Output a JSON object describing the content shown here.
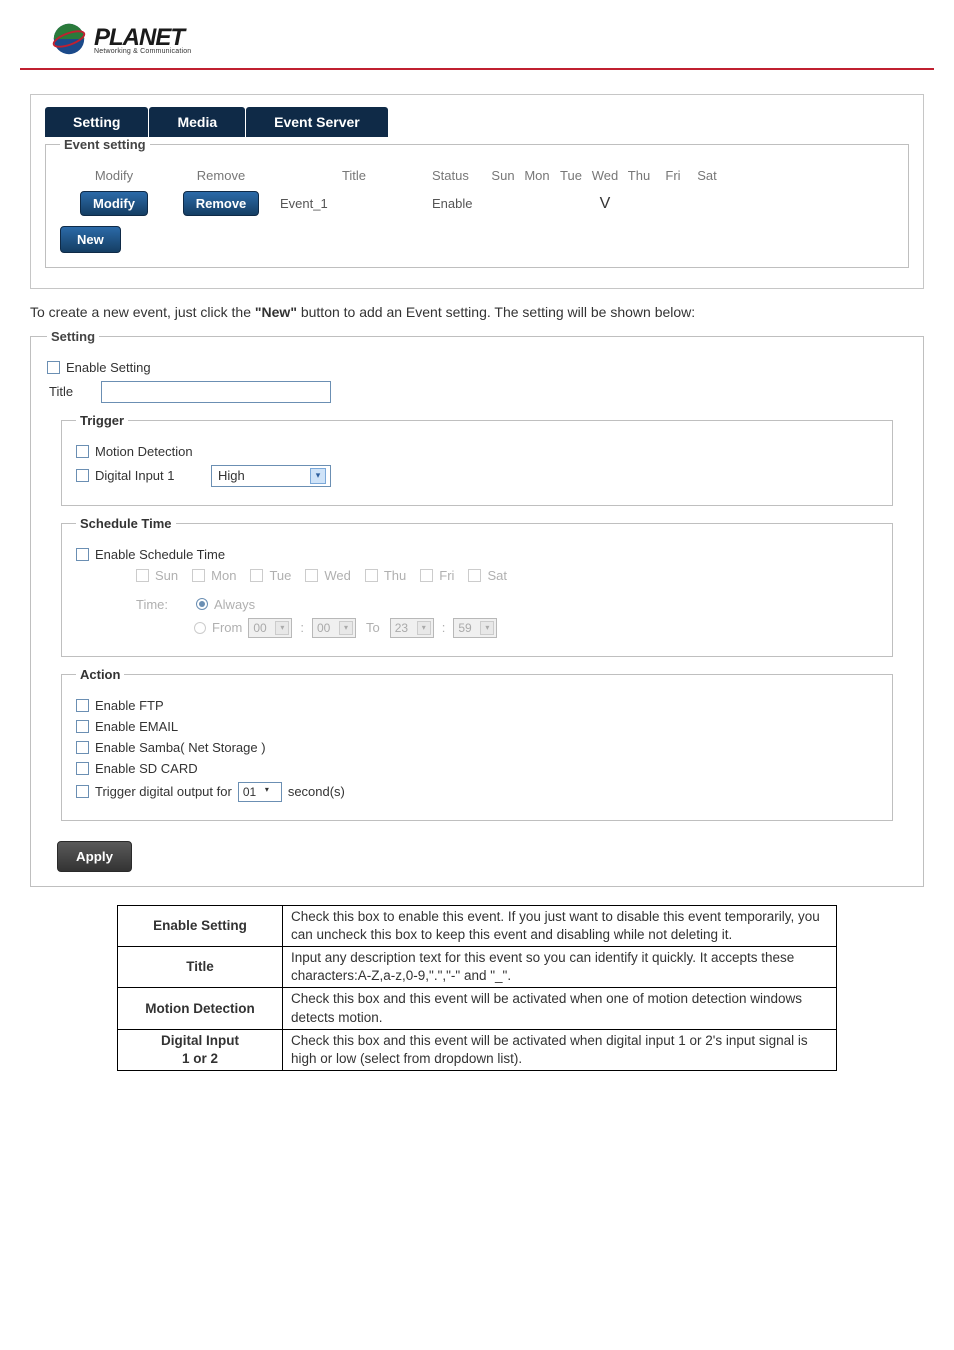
{
  "logo": {
    "brand": "PLANET",
    "tagline": "Networking & Communication"
  },
  "tabs": {
    "setting": "Setting",
    "media": "Media",
    "eventserver": "Event Server"
  },
  "eventSetting": {
    "legend": "Event setting",
    "headers": {
      "modify": "Modify",
      "remove": "Remove",
      "title": "Title",
      "status": "Status",
      "sun": "Sun",
      "mon": "Mon",
      "tue": "Tue",
      "wed": "Wed",
      "thu": "Thu",
      "fri": "Fri",
      "sat": "Sat"
    },
    "row": {
      "modify": "Modify",
      "remove": "Remove",
      "title": "Event_1",
      "status": "Enable",
      "wed": "V"
    },
    "newBtn": "New"
  },
  "paragraph": "To create a new event, just click the \"New\" button to add an Event setting. The setting will be shown below:",
  "setting": {
    "legend": "Setting",
    "enable": "Enable Setting",
    "titleLabel": "Title",
    "trigger": {
      "legend": "Trigger",
      "motion": "Motion Detection",
      "di1": "Digital Input 1",
      "di1val": "High"
    },
    "schedule": {
      "legend": "Schedule Time",
      "enable": "Enable Schedule Time",
      "days": {
        "sun": "Sun",
        "mon": "Mon",
        "tue": "Tue",
        "wed": "Wed",
        "thu": "Thu",
        "fri": "Fri",
        "sat": "Sat"
      },
      "timeLabel": "Time:",
      "always": "Always",
      "from": "From",
      "to": "To",
      "h1": "00",
      "m1": "00",
      "h2": "23",
      "m2": "59"
    },
    "action": {
      "legend": "Action",
      "ftp": "Enable FTP",
      "email": "Enable EMAIL",
      "samba": "Enable Samba( Net Storage )",
      "sd": "Enable SD CARD",
      "trigger_pre": "Trigger digital output for",
      "trigger_val": "01",
      "trigger_post": "second(s)"
    },
    "apply": "Apply"
  },
  "descTable": {
    "r1h": "Enable Setting",
    "r1": "Check this box to enable this event. If you just want to disable this event temporarily, you can uncheck this box to keep this event and disabling while not deleting it.",
    "r2h": "Title",
    "r2": "Input any description text for this event so you can identify it quickly. It accepts these characters:A-Z,a-z,0-9,\".\",\"-\" and \"_\".",
    "r3h": "Motion Detection",
    "r3": "Check this box and this event will be activated when one of motion detection windows detects motion.",
    "r4h": "Digital Input\n1 or 2",
    "r4": "Check this box and this event will be activated when digital input 1 or 2's input signal is high or low (select from dropdown list)."
  }
}
